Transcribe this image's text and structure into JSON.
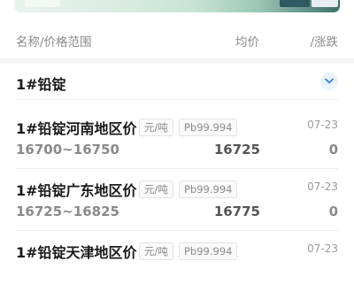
{
  "header": {
    "col_name": "名称/价格范围",
    "col_avg": "均价",
    "col_change": "涨跌",
    "col_change_prefix": "/"
  },
  "group": {
    "title": "1#铅锭",
    "expand_icon": "chevron-down-icon"
  },
  "rows": [
    {
      "name": "1#铅锭河南地区价",
      "unit": "元/吨",
      "grade": "Pb99.994",
      "date": "07-23",
      "range": "16700~16750",
      "avg": "16725",
      "change": "0"
    },
    {
      "name": "1#铅锭广东地区价",
      "unit": "元/吨",
      "grade": "Pb99.994",
      "date": "07-23",
      "range": "16725~16825",
      "avg": "16775",
      "change": "0"
    },
    {
      "name": "1#铅锭天津地区价",
      "unit": "元/吨",
      "grade": "Pb99.994",
      "date": "07-23",
      "range": "",
      "avg": "",
      "change": ""
    }
  ],
  "colors": {
    "accent": "#3d7bd9",
    "chip_bg": "#eaf2fb"
  }
}
